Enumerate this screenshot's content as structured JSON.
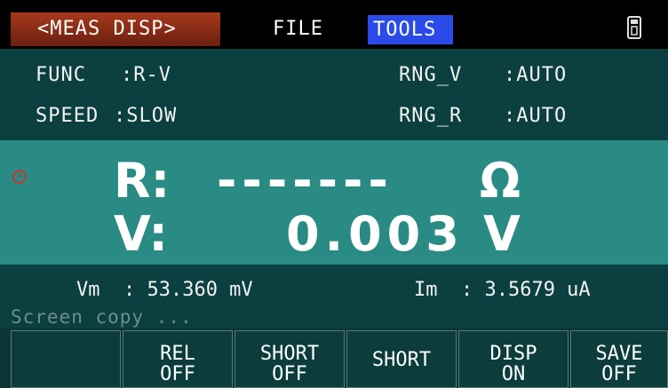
{
  "topbar": {
    "meas_tab": "<MEAS DISP>",
    "file_menu": "FILE",
    "tools_menu": "TOOLS",
    "usb_icon": "usb-drive-icon"
  },
  "params": {
    "func_label": "FUNC",
    "func_value": ":R-V",
    "speed_label": "SPEED",
    "speed_value": ":SLOW",
    "rng_v_label": "RNG_V",
    "rng_v_value": ":AUTO",
    "rng_r_label": "RNG_R",
    "rng_r_value": ":AUTO"
  },
  "display": {
    "r_label": "R:",
    "r_value": "-------",
    "r_unit": "Ω",
    "v_label": "V:",
    "v_value": "0.003",
    "v_unit": "V",
    "indicator_color": "#c0392b"
  },
  "readouts": {
    "vm": "Vm  : 53.360 mV",
    "im": "Im  : 3.5679 uA"
  },
  "status_message": "Screen copy ...",
  "softkeys": [
    {
      "line1": "",
      "line2": ""
    },
    {
      "line1": "REL",
      "line2": "OFF"
    },
    {
      "line1": "SHORT",
      "line2": "OFF"
    },
    {
      "line1": "SHORT",
      "line2": ""
    },
    {
      "line1": "DISP",
      "line2": "ON"
    },
    {
      "line1": "SAVE",
      "line2": "OFF"
    }
  ],
  "colors": {
    "background": "#0c3f3f",
    "display_band": "#2a8a84",
    "active_tab": "#a8391c",
    "tools_highlight": "#2a4be8"
  }
}
